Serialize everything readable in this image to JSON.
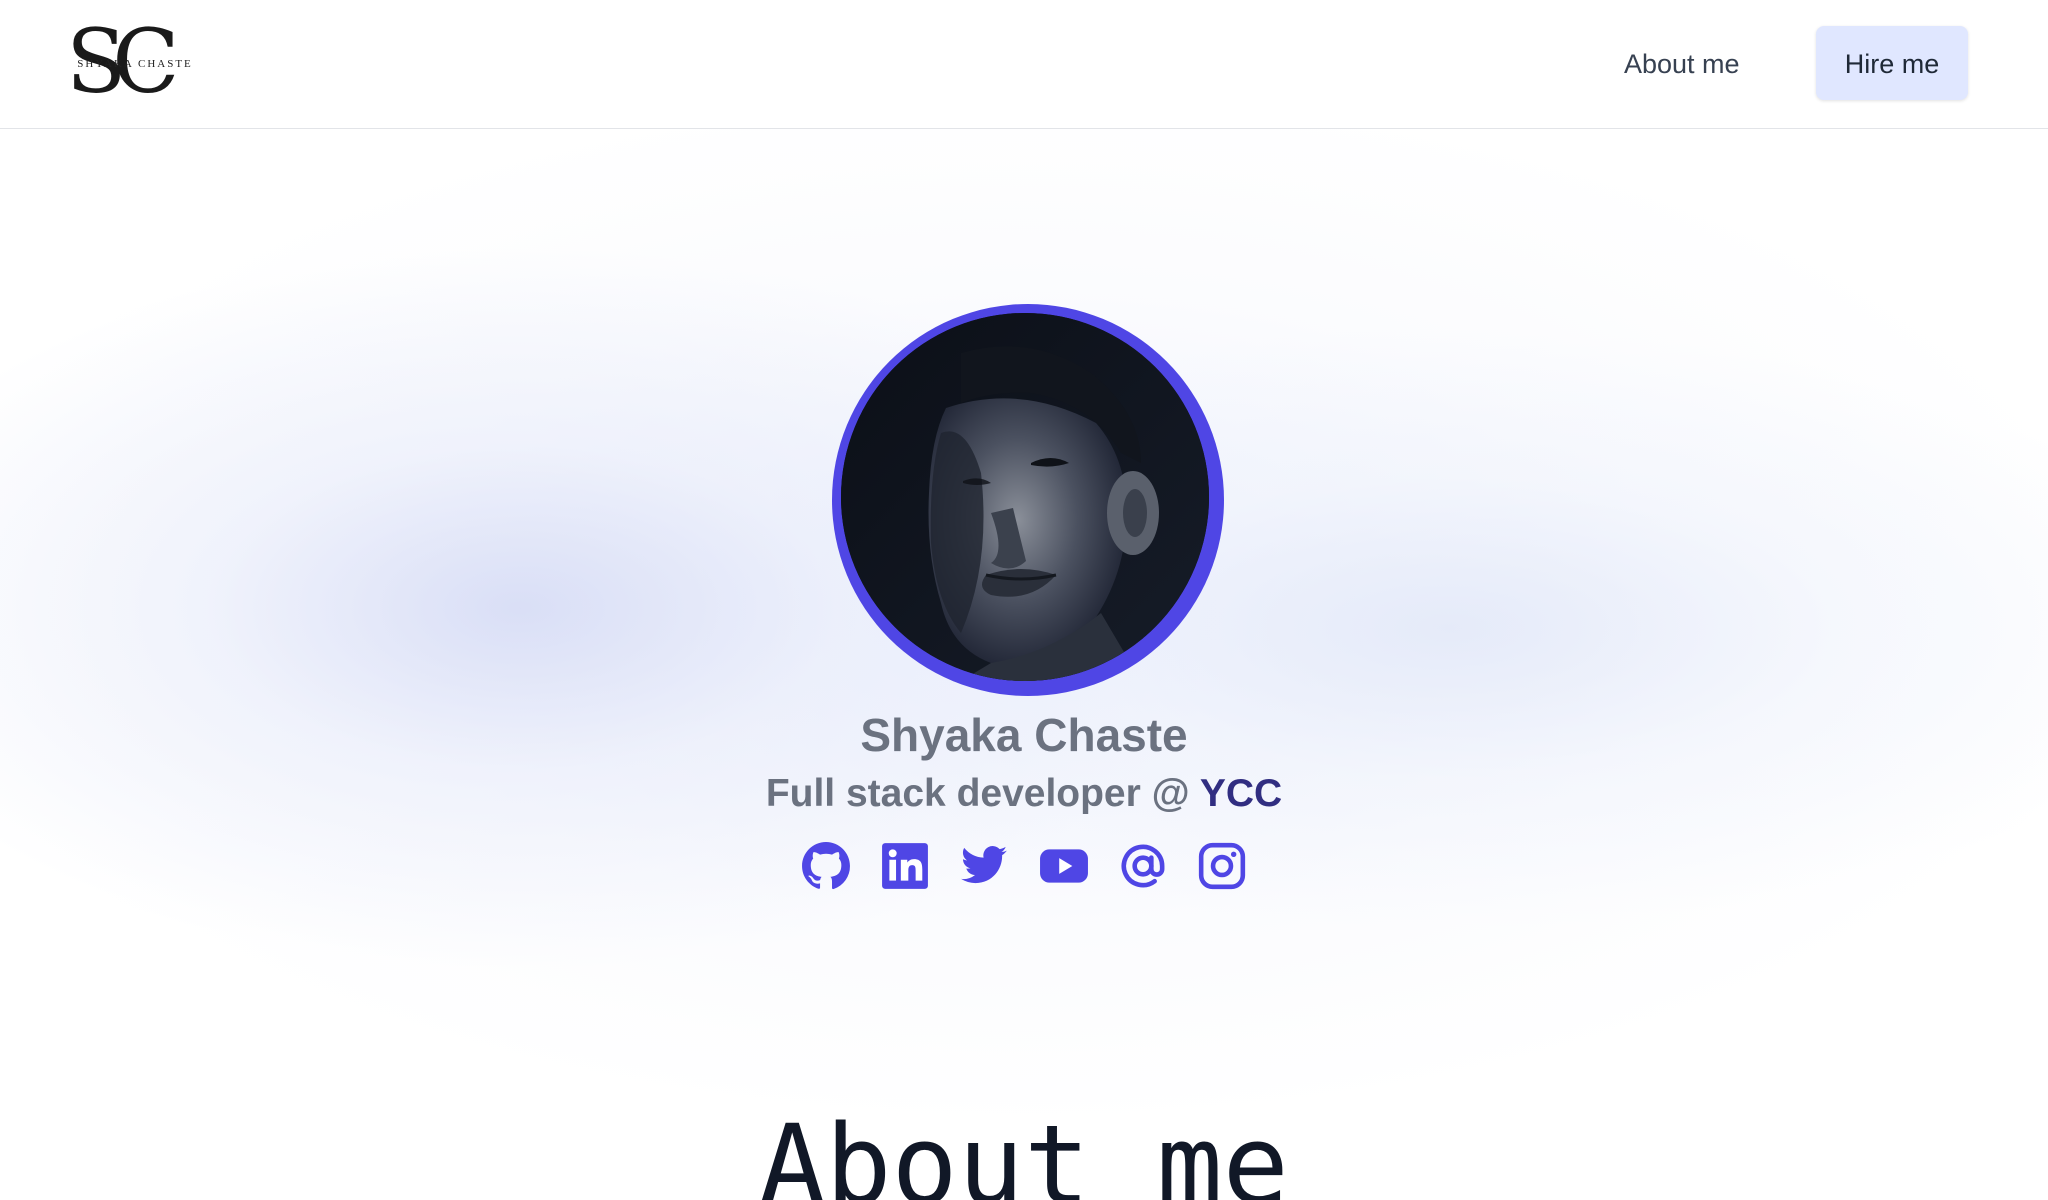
{
  "header": {
    "logo_letters": "SC",
    "logo_subtitle": "SHYAKA CHASTE",
    "nav_about": "About me",
    "nav_hire": "Hire me"
  },
  "hero": {
    "name": "Shyaka Chaste",
    "role_prefix": "Full stack developer @ ",
    "role_company": "YCC",
    "socials": [
      {
        "icon": "github-icon"
      },
      {
        "icon": "linkedin-icon"
      },
      {
        "icon": "twitter-icon"
      },
      {
        "icon": "youtube-icon"
      },
      {
        "icon": "email-icon"
      },
      {
        "icon": "instagram-icon"
      }
    ]
  },
  "about": {
    "heading": "About me"
  },
  "colors": {
    "accent": "#4f46e5",
    "company": "#312e81",
    "muted_text": "#6b7280",
    "hire_button_bg": "#e0e7ff"
  }
}
